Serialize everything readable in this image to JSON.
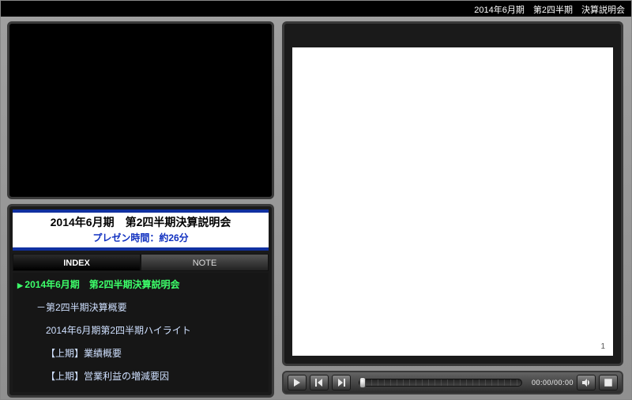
{
  "header": {
    "title": "2014年6月期　第2四半期　決算説明会"
  },
  "panel": {
    "title_main": "2014年6月期　第2四半期決算説明会",
    "title_sub": "プレゼン時間：約26分"
  },
  "tabs": {
    "index": "INDEX",
    "note": "NOTE"
  },
  "index_items": [
    {
      "label": "2014年6月期　第2四半期決算説明会",
      "level": 1,
      "current": true
    },
    {
      "label": "－第2四半期決算概要",
      "level": 2,
      "current": false
    },
    {
      "label": "2014年6月期第2四半期ハイライト",
      "level": 3,
      "current": false
    },
    {
      "label": "【上期】業績概要",
      "level": 3,
      "current": false
    },
    {
      "label": "【上期】営業利益の増減要因",
      "level": 3,
      "current": false
    }
  ],
  "slide": {
    "page_number": "1"
  },
  "player": {
    "time_label": "00:00/00:00"
  }
}
